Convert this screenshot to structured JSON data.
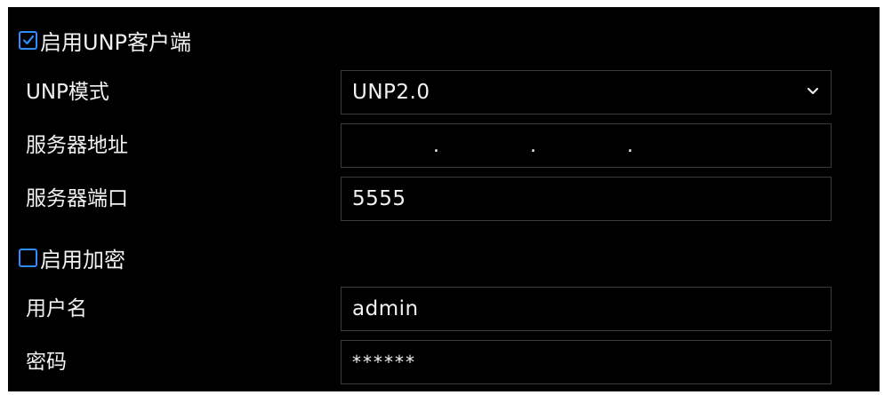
{
  "enable_unp_client": {
    "label": "启用UNP客户端",
    "checked": true
  },
  "unp_mode": {
    "label": "UNP模式",
    "value": "UNP2.0",
    "icon": "chevron-down-icon"
  },
  "server_address": {
    "label": "服务器地址",
    "dots": [
      ".",
      ".",
      "."
    ]
  },
  "server_port": {
    "label": "服务器端口",
    "value": "5555"
  },
  "enable_encryption": {
    "label": "启用加密",
    "checked": false
  },
  "username": {
    "label": "用户名",
    "value": "admin"
  },
  "password": {
    "label": "密码",
    "value": "******"
  },
  "colors": {
    "panel": "#000000",
    "accent": "#2d8cff",
    "field_border": "#3a3a3a",
    "text": "#f2f2f2"
  }
}
